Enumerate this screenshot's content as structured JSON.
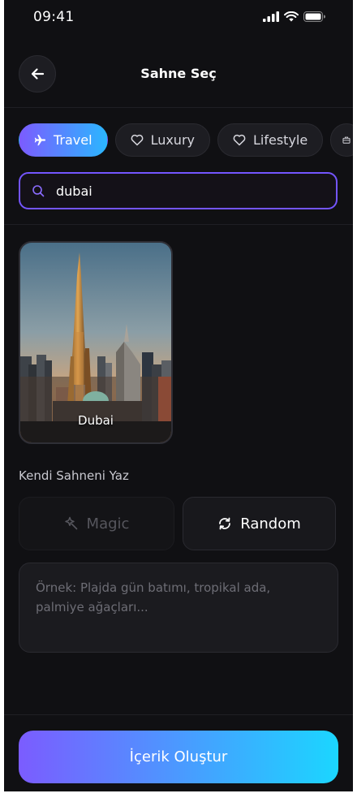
{
  "status_bar": {
    "time": "09:41",
    "icons": [
      "signal-icon",
      "wifi-icon",
      "battery-icon"
    ]
  },
  "header": {
    "title": "Sahne Seç",
    "back_icon": "arrow-left-icon"
  },
  "categories": [
    {
      "label": "Travel",
      "icon": "plane-icon",
      "active": true
    },
    {
      "label": "Luxury",
      "icon": "heart-icon",
      "active": false
    },
    {
      "label": "Lifestyle",
      "icon": "heart-icon",
      "active": false
    },
    {
      "label": "",
      "icon": "briefcase-icon",
      "active": false
    }
  ],
  "search": {
    "value": "dubai",
    "icon": "search-icon"
  },
  "scenes": [
    {
      "label": "Dubai"
    }
  ],
  "custom": {
    "section_label": "Kendi Sahneni Yaz",
    "magic_label": "Magic",
    "random_label": "Random",
    "prompt_placeholder": "Örnek: Plajda gün batımı, tropikal ada, palmiye ağaçları..."
  },
  "cta": {
    "label": "İçerik Oluştur"
  },
  "colors": {
    "accent_start": "#7b5cff",
    "accent_end": "#1bd6ff",
    "background": "#101013"
  }
}
